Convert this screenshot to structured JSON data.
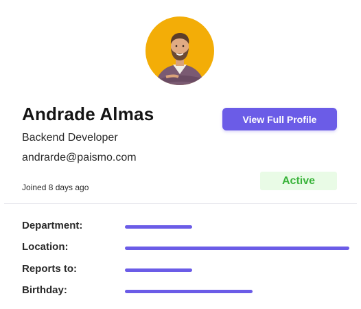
{
  "profile": {
    "name": "Andrade Almas",
    "role": "Backend Developer",
    "email": "andrarde@paismo.com",
    "joined": "Joined 8 days ago",
    "status": "Active",
    "view_button_label": "View Full Profile"
  },
  "details": [
    {
      "label": "Department:",
      "bar_fraction": 0.3
    },
    {
      "label": "Location:",
      "bar_fraction": 1.0
    },
    {
      "label": "Reports to:",
      "bar_fraction": 0.3
    },
    {
      "label": "Birthday:",
      "bar_fraction": 0.57
    }
  ],
  "colors": {
    "accent": "#6b5ce7",
    "status_text": "#39b33a",
    "status_bg": "#e9fbe6",
    "avatar_bg": "#f3ad07"
  }
}
